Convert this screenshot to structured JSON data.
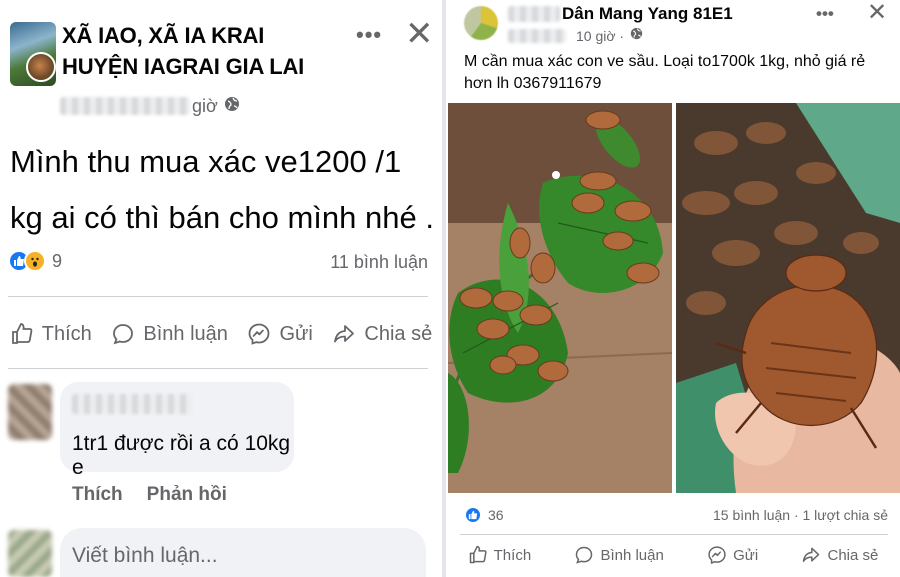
{
  "left_post": {
    "group_name": "XÃ IAO, XÃ IA KRAI HUYỆN IAGRAI GIA LAI",
    "meta_time": "giờ",
    "body": "Mình thu mua xác ve1200 /1 kg ai có thì  bán cho mình nhé .",
    "reaction_count": "9",
    "comment_count": "11 bình luận",
    "actions": {
      "like": "Thích",
      "comment": "Bình luận",
      "send": "Gửi",
      "share": "Chia sẻ"
    },
    "comment": {
      "text": "1tr1 được rồi a có 10kg e",
      "like": "Thích",
      "reply": "Phản hồi"
    },
    "write_comment_placeholder": "Viết bình luận..."
  },
  "right_post": {
    "title": "Dân Mang Yang 81E1",
    "meta_time": "10 giờ ·",
    "body": "M cần mua xác con ve sầu. Loại to1700k 1kg, nhỏ giá rẻ hơn  lh 0367911679",
    "reaction_count": "36",
    "stats": "15 bình luận · 1 lượt chia sẻ",
    "actions": {
      "like": "Thích",
      "comment": "Bình luận",
      "send": "Gửi",
      "share": "Chia sẻ"
    }
  },
  "colors": {
    "facebook_blue": "#1877f2",
    "secondary_text": "#65676b",
    "comment_bg": "#f0f2f5"
  }
}
